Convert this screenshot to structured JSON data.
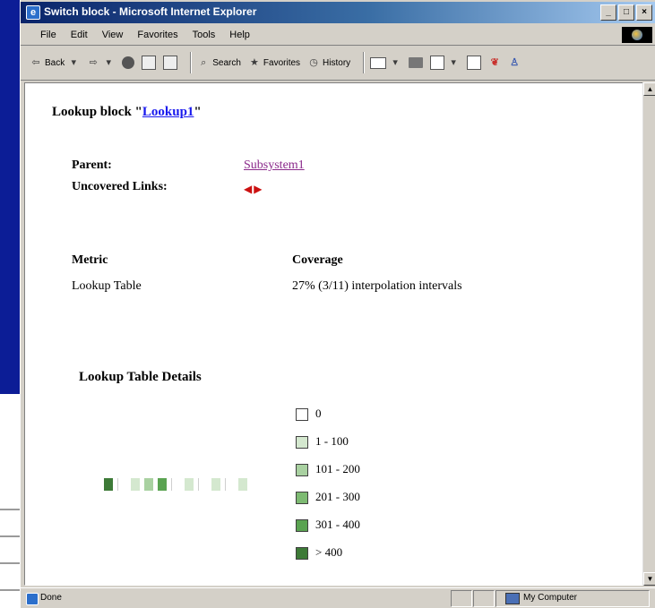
{
  "window": {
    "title": "Switch block - Microsoft Internet Explorer",
    "controls": [
      "_",
      "□",
      "×"
    ]
  },
  "menu": [
    "File",
    "Edit",
    "View",
    "Favorites",
    "Tools",
    "Help"
  ],
  "toolbar": {
    "back": "Back",
    "search": "Search",
    "favorites": "Favorites",
    "history": "History"
  },
  "page": {
    "heading_prefix": "Lookup block \"",
    "heading_link": "Lookup1",
    "heading_suffix": "\"",
    "parent_label": "Parent:",
    "parent_value": "Subsystem1",
    "uncovered_label": "Uncovered Links:",
    "metric_header": "Metric",
    "coverage_header": "Coverage",
    "metric_row": {
      "metric": "Lookup Table",
      "coverage": "27% (3/11) interpolation intervals"
    },
    "details_heading": "Lookup Table Details",
    "legend": [
      {
        "label": "0",
        "color": "#ffffff"
      },
      {
        "label": "1 - 100",
        "color": "#d4e8cf"
      },
      {
        "label": "101 - 200",
        "color": "#a9d1a1"
      },
      {
        "label": "201 - 300",
        "color": "#7dba72"
      },
      {
        "label": "301 - 400",
        "color": "#5aa351"
      },
      {
        "label": "> 400",
        "color": "#3d7a37"
      }
    ],
    "coverage_cells": [
      {
        "color": "#3d7a37"
      },
      {
        "color": "#ffffff"
      },
      {
        "color": "#d4e8cf"
      },
      {
        "color": "#a9d1a1"
      },
      {
        "color": "#5aa351"
      },
      {
        "color": "#ffffff"
      },
      {
        "color": "#d4e8cf"
      },
      {
        "color": "#ffffff"
      },
      {
        "color": "#d4e8cf"
      },
      {
        "color": "#ffffff"
      },
      {
        "color": "#d4e8cf"
      }
    ]
  },
  "status": {
    "text": "Done",
    "zone": "My Computer"
  }
}
